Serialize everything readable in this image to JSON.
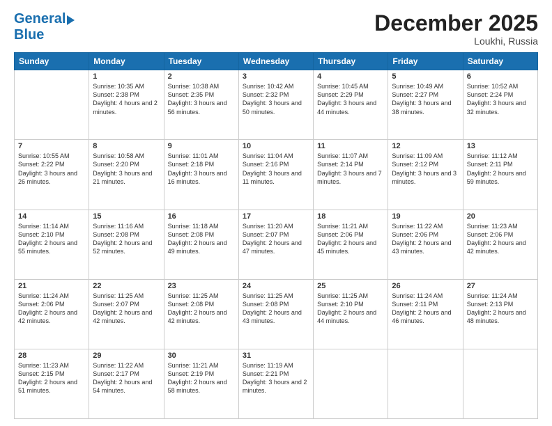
{
  "header": {
    "logo_line1": "General",
    "logo_line2": "Blue",
    "month": "December 2025",
    "location": "Loukhi, Russia"
  },
  "days_of_week": [
    "Sunday",
    "Monday",
    "Tuesday",
    "Wednesday",
    "Thursday",
    "Friday",
    "Saturday"
  ],
  "weeks": [
    [
      {
        "day": "",
        "sunrise": "",
        "sunset": "",
        "daylight": ""
      },
      {
        "day": "1",
        "sunrise": "Sunrise: 10:35 AM",
        "sunset": "Sunset: 2:38 PM",
        "daylight": "Daylight: 4 hours and 2 minutes."
      },
      {
        "day": "2",
        "sunrise": "Sunrise: 10:38 AM",
        "sunset": "Sunset: 2:35 PM",
        "daylight": "Daylight: 3 hours and 56 minutes."
      },
      {
        "day": "3",
        "sunrise": "Sunrise: 10:42 AM",
        "sunset": "Sunset: 2:32 PM",
        "daylight": "Daylight: 3 hours and 50 minutes."
      },
      {
        "day": "4",
        "sunrise": "Sunrise: 10:45 AM",
        "sunset": "Sunset: 2:29 PM",
        "daylight": "Daylight: 3 hours and 44 minutes."
      },
      {
        "day": "5",
        "sunrise": "Sunrise: 10:49 AM",
        "sunset": "Sunset: 2:27 PM",
        "daylight": "Daylight: 3 hours and 38 minutes."
      },
      {
        "day": "6",
        "sunrise": "Sunrise: 10:52 AM",
        "sunset": "Sunset: 2:24 PM",
        "daylight": "Daylight: 3 hours and 32 minutes."
      }
    ],
    [
      {
        "day": "7",
        "sunrise": "Sunrise: 10:55 AM",
        "sunset": "Sunset: 2:22 PM",
        "daylight": "Daylight: 3 hours and 26 minutes."
      },
      {
        "day": "8",
        "sunrise": "Sunrise: 10:58 AM",
        "sunset": "Sunset: 2:20 PM",
        "daylight": "Daylight: 3 hours and 21 minutes."
      },
      {
        "day": "9",
        "sunrise": "Sunrise: 11:01 AM",
        "sunset": "Sunset: 2:18 PM",
        "daylight": "Daylight: 3 hours and 16 minutes."
      },
      {
        "day": "10",
        "sunrise": "Sunrise: 11:04 AM",
        "sunset": "Sunset: 2:16 PM",
        "daylight": "Daylight: 3 hours and 11 minutes."
      },
      {
        "day": "11",
        "sunrise": "Sunrise: 11:07 AM",
        "sunset": "Sunset: 2:14 PM",
        "daylight": "Daylight: 3 hours and 7 minutes."
      },
      {
        "day": "12",
        "sunrise": "Sunrise: 11:09 AM",
        "sunset": "Sunset: 2:12 PM",
        "daylight": "Daylight: 3 hours and 3 minutes."
      },
      {
        "day": "13",
        "sunrise": "Sunrise: 11:12 AM",
        "sunset": "Sunset: 2:11 PM",
        "daylight": "Daylight: 2 hours and 59 minutes."
      }
    ],
    [
      {
        "day": "14",
        "sunrise": "Sunrise: 11:14 AM",
        "sunset": "Sunset: 2:10 PM",
        "daylight": "Daylight: 2 hours and 55 minutes."
      },
      {
        "day": "15",
        "sunrise": "Sunrise: 11:16 AM",
        "sunset": "Sunset: 2:08 PM",
        "daylight": "Daylight: 2 hours and 52 minutes."
      },
      {
        "day": "16",
        "sunrise": "Sunrise: 11:18 AM",
        "sunset": "Sunset: 2:08 PM",
        "daylight": "Daylight: 2 hours and 49 minutes."
      },
      {
        "day": "17",
        "sunrise": "Sunrise: 11:20 AM",
        "sunset": "Sunset: 2:07 PM",
        "daylight": "Daylight: 2 hours and 47 minutes."
      },
      {
        "day": "18",
        "sunrise": "Sunrise: 11:21 AM",
        "sunset": "Sunset: 2:06 PM",
        "daylight": "Daylight: 2 hours and 45 minutes."
      },
      {
        "day": "19",
        "sunrise": "Sunrise: 11:22 AM",
        "sunset": "Sunset: 2:06 PM",
        "daylight": "Daylight: 2 hours and 43 minutes."
      },
      {
        "day": "20",
        "sunrise": "Sunrise: 11:23 AM",
        "sunset": "Sunset: 2:06 PM",
        "daylight": "Daylight: 2 hours and 42 minutes."
      }
    ],
    [
      {
        "day": "21",
        "sunrise": "Sunrise: 11:24 AM",
        "sunset": "Sunset: 2:06 PM",
        "daylight": "Daylight: 2 hours and 42 minutes."
      },
      {
        "day": "22",
        "sunrise": "Sunrise: 11:25 AM",
        "sunset": "Sunset: 2:07 PM",
        "daylight": "Daylight: 2 hours and 42 minutes."
      },
      {
        "day": "23",
        "sunrise": "Sunrise: 11:25 AM",
        "sunset": "Sunset: 2:08 PM",
        "daylight": "Daylight: 2 hours and 42 minutes."
      },
      {
        "day": "24",
        "sunrise": "Sunrise: 11:25 AM",
        "sunset": "Sunset: 2:08 PM",
        "daylight": "Daylight: 2 hours and 43 minutes."
      },
      {
        "day": "25",
        "sunrise": "Sunrise: 11:25 AM",
        "sunset": "Sunset: 2:10 PM",
        "daylight": "Daylight: 2 hours and 44 minutes."
      },
      {
        "day": "26",
        "sunrise": "Sunrise: 11:24 AM",
        "sunset": "Sunset: 2:11 PM",
        "daylight": "Daylight: 2 hours and 46 minutes."
      },
      {
        "day": "27",
        "sunrise": "Sunrise: 11:24 AM",
        "sunset": "Sunset: 2:13 PM",
        "daylight": "Daylight: 2 hours and 48 minutes."
      }
    ],
    [
      {
        "day": "28",
        "sunrise": "Sunrise: 11:23 AM",
        "sunset": "Sunset: 2:15 PM",
        "daylight": "Daylight: 2 hours and 51 minutes."
      },
      {
        "day": "29",
        "sunrise": "Sunrise: 11:22 AM",
        "sunset": "Sunset: 2:17 PM",
        "daylight": "Daylight: 2 hours and 54 minutes."
      },
      {
        "day": "30",
        "sunrise": "Sunrise: 11:21 AM",
        "sunset": "Sunset: 2:19 PM",
        "daylight": "Daylight: 2 hours and 58 minutes."
      },
      {
        "day": "31",
        "sunrise": "Sunrise: 11:19 AM",
        "sunset": "Sunset: 2:21 PM",
        "daylight": "Daylight: 3 hours and 2 minutes."
      },
      {
        "day": "",
        "sunrise": "",
        "sunset": "",
        "daylight": ""
      },
      {
        "day": "",
        "sunrise": "",
        "sunset": "",
        "daylight": ""
      },
      {
        "day": "",
        "sunrise": "",
        "sunset": "",
        "daylight": ""
      }
    ]
  ]
}
